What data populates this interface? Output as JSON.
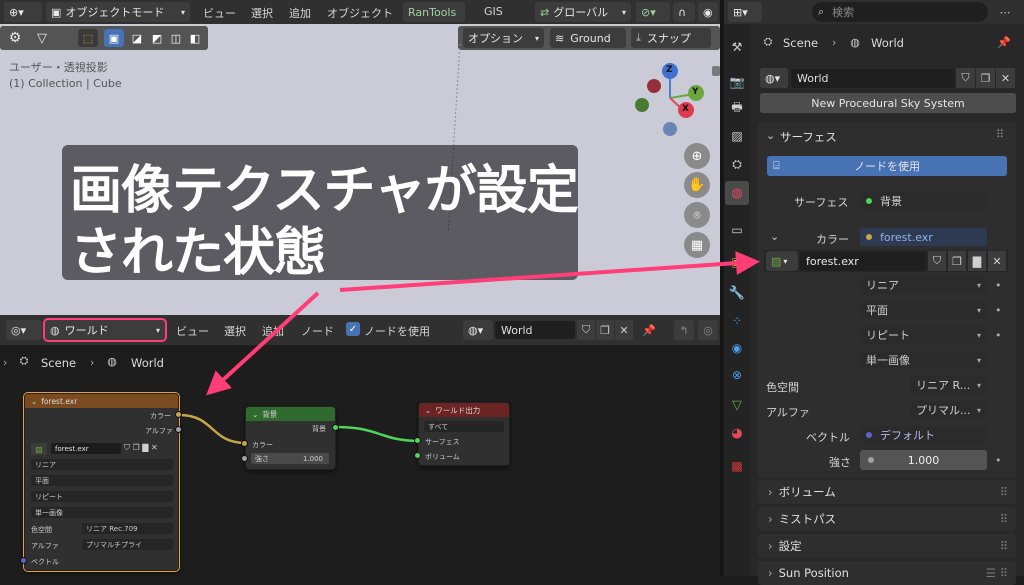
{
  "topbar": {
    "mode": "オブジェクトモード",
    "menus": [
      "ビュー",
      "選択",
      "追加",
      "オブジェクト"
    ],
    "rantools": "RanTools",
    "gis": "GIS",
    "orientation": "グローバル"
  },
  "viewport": {
    "options": "オプション",
    "ground": "Ground",
    "snap": "スナップ",
    "view_name": "ユーザー・透視投影",
    "collection": "(1) Collection | Cube",
    "gizmo": {
      "z": "Z",
      "y": "Y",
      "x": "X"
    }
  },
  "caption": {
    "line1": "画像テクスチャが設定",
    "line2": "された状態"
  },
  "node_header": {
    "world_dropdown": "ワールド",
    "menus": [
      "ビュー",
      "選択",
      "追加",
      "ノード"
    ],
    "use_nodes": "ノードを使用",
    "world_name": "World"
  },
  "breadcrumb": {
    "scene": "Scene",
    "world": "World"
  },
  "nodes": {
    "image": {
      "title": "forest.exr",
      "out_color": "カラー",
      "out_alpha": "アルファ",
      "file": "forest.exr",
      "interp": "リニア",
      "proj": "平面",
      "ext": "リピート",
      "source": "単一画像",
      "cs_label": "色空間",
      "cs_value": "リニア Rec.709",
      "alpha_label": "アルファ",
      "alpha_value": "プリマルチプライ",
      "vector": "ベクトル"
    },
    "background": {
      "title": "背景",
      "out": "背景",
      "in_color": "カラー",
      "strength_label": "強さ",
      "strength_value": "1.000"
    },
    "output": {
      "title": "ワールド出力",
      "target": "すべて",
      "surface": "サーフェス",
      "volume": "ボリューム"
    }
  },
  "properties": {
    "search_placeholder": "検索",
    "breadcrumb_scene": "Scene",
    "breadcrumb_world": "World",
    "world_name": "World",
    "sky_button": "New Procedural Sky System",
    "surface_section": "サーフェス",
    "use_nodes_button": "ノードを使用",
    "surface_label": "サーフェス",
    "surface_value": "背景",
    "color_label": "カラー",
    "color_value": "forest.exr",
    "image_name": "forest.exr",
    "interp": "リニア",
    "proj": "平面",
    "ext": "リピート",
    "source": "単一画像",
    "colorspace_label": "色空間",
    "colorspace_value": "リニア R...",
    "alpha_label": "アルファ",
    "alpha_value": "プリマル...",
    "vector_label": "ベクトル",
    "vector_value": "デフォルト",
    "strength_label": "強さ",
    "strength_value": "1.000",
    "sections": [
      "ボリューム",
      "ミストパス",
      "設定",
      "Sun Position"
    ]
  },
  "colors": {
    "accent_blue": "#4772b3",
    "highlight_pink": "#ff3d77",
    "viewport_bg": "#cbcbd8",
    "image_node_header": "#7a4a20",
    "background_node_header": "#2f6b2f",
    "output_node_header": "#6b2323"
  }
}
